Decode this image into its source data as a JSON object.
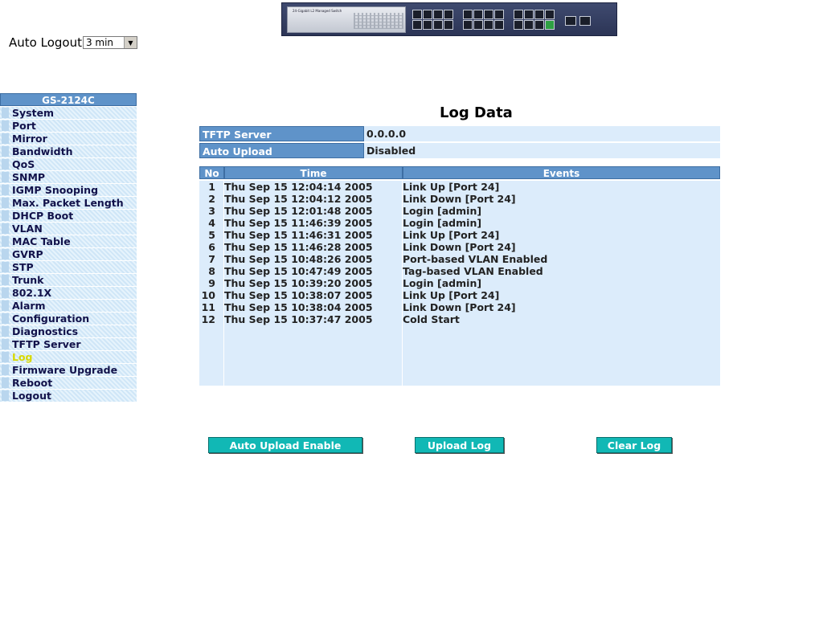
{
  "banner": {
    "brand_text": "24-Gigabit L2 Managed Switch"
  },
  "auto_logout": {
    "label": "Auto Logout",
    "value": "3 min"
  },
  "menu": {
    "title": "GS-2124C",
    "items": [
      {
        "label": "System"
      },
      {
        "label": "Port"
      },
      {
        "label": "Mirror"
      },
      {
        "label": "Bandwidth"
      },
      {
        "label": "QoS"
      },
      {
        "label": "SNMP"
      },
      {
        "label": "IGMP Snooping"
      },
      {
        "label": "Max. Packet Length"
      },
      {
        "label": "DHCP Boot"
      },
      {
        "label": "VLAN"
      },
      {
        "label": "MAC Table"
      },
      {
        "label": "GVRP"
      },
      {
        "label": "STP"
      },
      {
        "label": "Trunk"
      },
      {
        "label": "802.1X"
      },
      {
        "label": "Alarm"
      },
      {
        "label": "Configuration"
      },
      {
        "label": "Diagnostics"
      },
      {
        "label": "TFTP Server"
      },
      {
        "label": "Log",
        "active": true
      },
      {
        "label": "Firmware Upgrade"
      },
      {
        "label": "Reboot"
      },
      {
        "label": "Logout"
      }
    ]
  },
  "page_title": "Log Data",
  "info": {
    "tftp_label": "TFTP Server",
    "tftp_value": "0.0.0.0",
    "upload_label": "Auto Upload",
    "upload_value": "Disabled"
  },
  "log_table": {
    "headers": [
      "No",
      "Time",
      "Events"
    ],
    "rows": [
      [
        "1",
        "Thu Sep 15 12:04:14 2005",
        "Link Up [Port 24]"
      ],
      [
        "2",
        "Thu Sep 15 12:04:12 2005",
        "Link Down [Port 24]"
      ],
      [
        "3",
        "Thu Sep 15 12:01:48 2005",
        "Login [admin]"
      ],
      [
        "4",
        "Thu Sep 15 11:46:39 2005",
        "Login [admin]"
      ],
      [
        "5",
        "Thu Sep 15 11:46:31 2005",
        "Link Up [Port 24]"
      ],
      [
        "6",
        "Thu Sep 15 11:46:28 2005",
        "Link Down [Port 24]"
      ],
      [
        "7",
        "Thu Sep 15 10:48:26 2005",
        "Port-based VLAN Enabled"
      ],
      [
        "8",
        "Thu Sep 15 10:47:49 2005",
        "Tag-based VLAN Enabled"
      ],
      [
        "9",
        "Thu Sep 15 10:39:20 2005",
        "Login [admin]"
      ],
      [
        "10",
        "Thu Sep 15 10:38:07 2005",
        "Link Up [Port 24]"
      ],
      [
        "11",
        "Thu Sep 15 10:38:04 2005",
        "Link Down [Port 24]"
      ],
      [
        "12",
        "Thu Sep 15 10:37:47 2005",
        "Cold Start"
      ],
      [
        "",
        "",
        ""
      ],
      [
        "",
        "",
        ""
      ],
      [
        "",
        "",
        ""
      ],
      [
        "",
        "",
        ""
      ],
      [
        "",
        "",
        ""
      ]
    ]
  },
  "buttons": {
    "auto_upload": "Auto Upload Enable",
    "upload_log": "Upload Log",
    "clear_log": "Clear Log"
  },
  "colors": {
    "header_blue": "#5f93c9",
    "cell_blue": "#dcecfb",
    "button_teal": "#11b8b5",
    "active_menu": "#d8d800"
  }
}
